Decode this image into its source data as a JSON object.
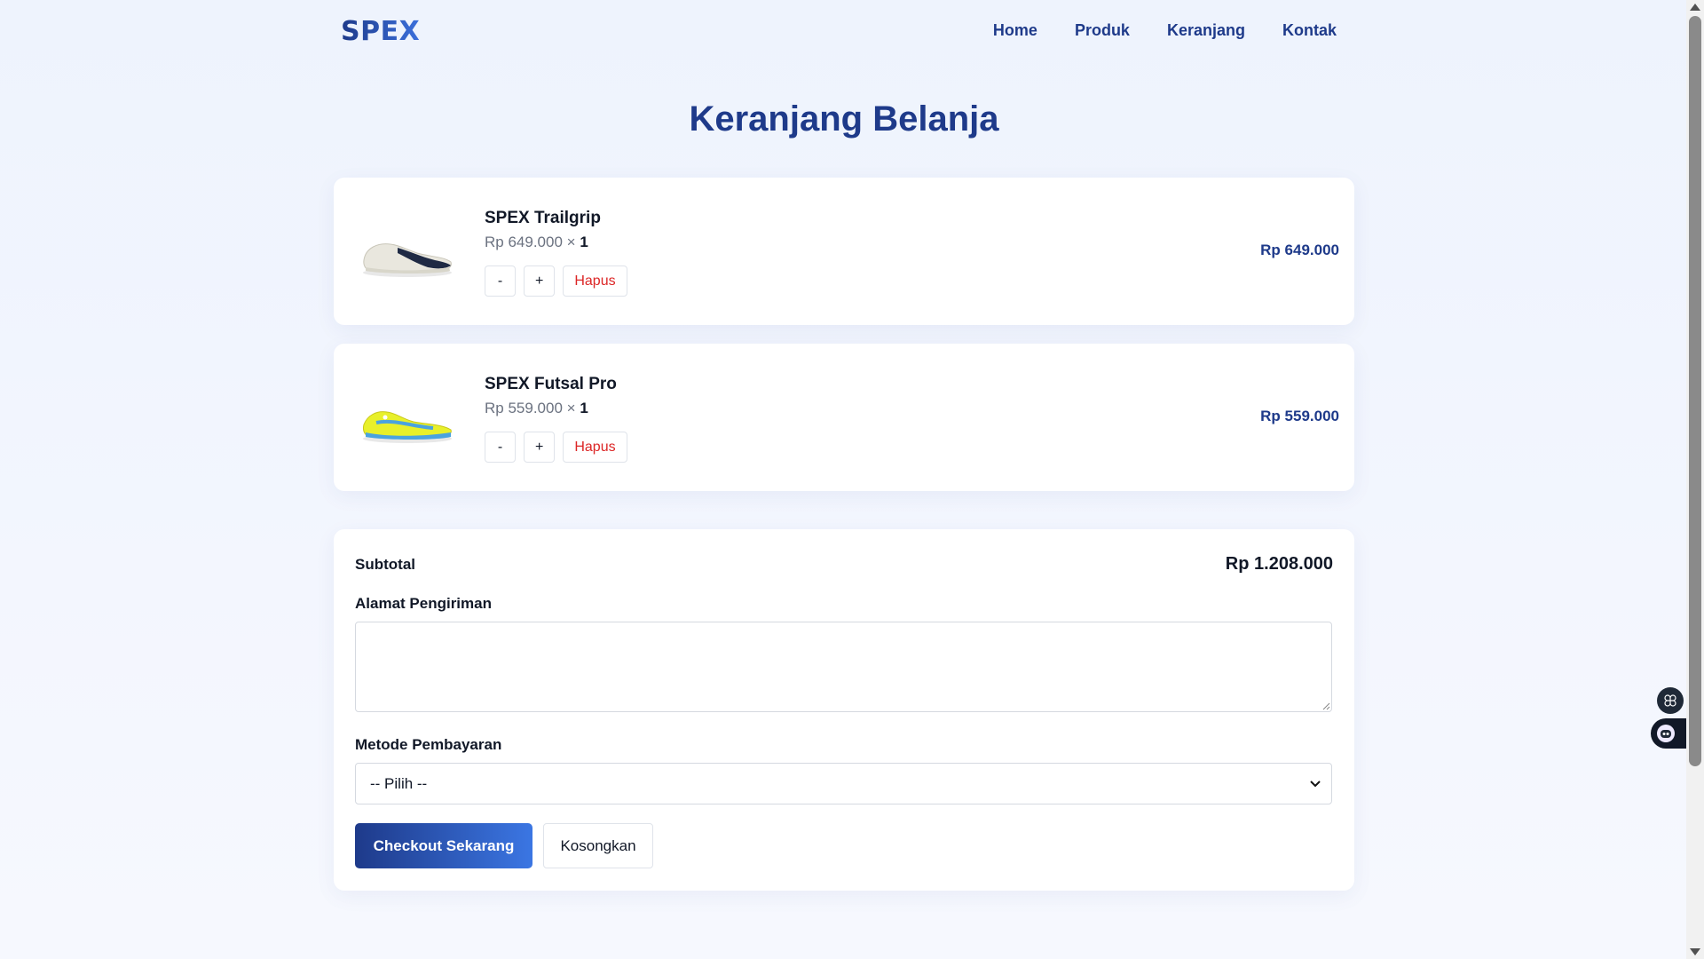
{
  "brand": {
    "logo": "SPEX"
  },
  "nav": {
    "items": [
      "Home",
      "Produk",
      "Keranjang",
      "Kontak"
    ]
  },
  "page": {
    "title": "Keranjang Belanja"
  },
  "cart": {
    "items": [
      {
        "name": "SPEX Trailgrip",
        "unit_price": "Rp 649.000",
        "times": "×",
        "qty": "1",
        "total": "Rp 649.000",
        "image_icon": "shoe-white-image"
      },
      {
        "name": "SPEX Futsal Pro",
        "unit_price": "Rp 559.000",
        "times": "×",
        "qty": "1",
        "total": "Rp 559.000",
        "image_icon": "shoe-yellow-image"
      }
    ],
    "controls": {
      "decrease": "-",
      "increase": "+",
      "remove": "Hapus"
    }
  },
  "summary": {
    "subtotal_label": "Subtotal",
    "subtotal_value": "Rp 1.208.000",
    "address_label": "Alamat Pengiriman",
    "address_value": "",
    "payment_label": "Metode Pembayaran",
    "payment_selected": "-- Pilih --",
    "checkout_label": "Checkout Sekarang",
    "clear_label": "Kosongkan"
  },
  "colors": {
    "primary": "#1e3a8a",
    "accent": "#3b76e3",
    "danger": "#dc2626",
    "background": "#eef3fd"
  }
}
